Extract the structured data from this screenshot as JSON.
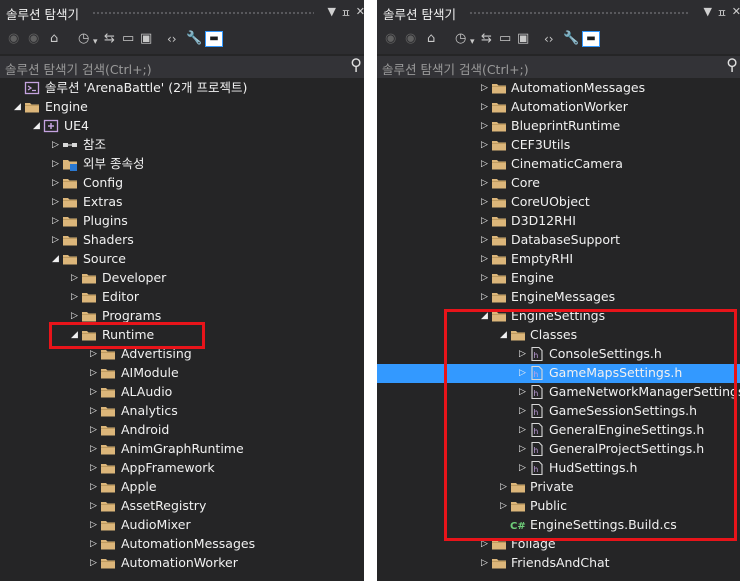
{
  "panels": [
    {
      "title": "솔루션 탐색기",
      "title_icons": [
        "▼",
        "ㅍ",
        "✕"
      ],
      "search_placeholder": "솔루션 탐색기 검색(Ctrl+;)",
      "rows": [
        {
          "label": "솔루션 'ArenaBattle' (2개 프로젝트)",
          "icon": "solution-icon",
          "level": 0,
          "exp": "none",
          "sel": false
        },
        {
          "label": "Engine",
          "icon": "folder-icon",
          "level": 0,
          "exp": "open",
          "sel": false
        },
        {
          "label": "UE4",
          "icon": "project-icon",
          "level": 1,
          "exp": "open",
          "sel": false
        },
        {
          "label": "참조",
          "icon": "references-icon",
          "level": 2,
          "exp": "closed",
          "sel": false
        },
        {
          "label": "외부 종속성",
          "icon": "external-deps-icon",
          "level": 2,
          "exp": "closed",
          "sel": false
        },
        {
          "label": "Config",
          "icon": "folder-icon",
          "level": 2,
          "exp": "closed",
          "sel": false
        },
        {
          "label": "Extras",
          "icon": "folder-icon",
          "level": 2,
          "exp": "closed",
          "sel": false
        },
        {
          "label": "Plugins",
          "icon": "folder-icon",
          "level": 2,
          "exp": "closed",
          "sel": false
        },
        {
          "label": "Shaders",
          "icon": "folder-icon",
          "level": 2,
          "exp": "closed",
          "sel": false
        },
        {
          "label": "Source",
          "icon": "folder-icon",
          "level": 2,
          "exp": "open",
          "sel": false
        },
        {
          "label": "Developer",
          "icon": "folder-icon",
          "level": 3,
          "exp": "closed",
          "sel": false
        },
        {
          "label": "Editor",
          "icon": "folder-icon",
          "level": 3,
          "exp": "closed",
          "sel": false
        },
        {
          "label": "Programs",
          "icon": "folder-icon",
          "level": 3,
          "exp": "closed",
          "sel": false
        },
        {
          "label": "Runtime",
          "icon": "folder-icon",
          "level": 3,
          "exp": "open",
          "sel": false
        },
        {
          "label": "Advertising",
          "icon": "folder-icon",
          "level": 4,
          "exp": "closed",
          "sel": false
        },
        {
          "label": "AIModule",
          "icon": "folder-icon",
          "level": 4,
          "exp": "closed",
          "sel": false
        },
        {
          "label": "ALAudio",
          "icon": "folder-icon",
          "level": 4,
          "exp": "closed",
          "sel": false
        },
        {
          "label": "Analytics",
          "icon": "folder-icon",
          "level": 4,
          "exp": "closed",
          "sel": false
        },
        {
          "label": "Android",
          "icon": "folder-icon",
          "level": 4,
          "exp": "closed",
          "sel": false
        },
        {
          "label": "AnimGraphRuntime",
          "icon": "folder-icon",
          "level": 4,
          "exp": "closed",
          "sel": false
        },
        {
          "label": "AppFramework",
          "icon": "folder-icon",
          "level": 4,
          "exp": "closed",
          "sel": false
        },
        {
          "label": "Apple",
          "icon": "folder-icon",
          "level": 4,
          "exp": "closed",
          "sel": false
        },
        {
          "label": "AssetRegistry",
          "icon": "folder-icon",
          "level": 4,
          "exp": "closed",
          "sel": false
        },
        {
          "label": "AudioMixer",
          "icon": "folder-icon",
          "level": 4,
          "exp": "closed",
          "sel": false
        },
        {
          "label": "AutomationMessages",
          "icon": "folder-icon",
          "level": 4,
          "exp": "closed",
          "sel": false
        },
        {
          "label": "AutomationWorker",
          "icon": "folder-icon",
          "level": 4,
          "exp": "closed",
          "sel": false
        }
      ]
    },
    {
      "title": "솔루션 탐색기",
      "title_icons": [
        "▼",
        "ㅍ",
        "✕"
      ],
      "search_placeholder": "솔루션 탐색기 검색(Ctrl+;)",
      "rows": [
        {
          "label": "AutomationMessages",
          "icon": "folder-icon",
          "level": 1,
          "exp": "closed",
          "sel": false
        },
        {
          "label": "AutomationWorker",
          "icon": "folder-icon",
          "level": 1,
          "exp": "closed",
          "sel": false
        },
        {
          "label": "BlueprintRuntime",
          "icon": "folder-icon",
          "level": 1,
          "exp": "closed",
          "sel": false
        },
        {
          "label": "CEF3Utils",
          "icon": "folder-icon",
          "level": 1,
          "exp": "closed",
          "sel": false
        },
        {
          "label": "CinematicCamera",
          "icon": "folder-icon",
          "level": 1,
          "exp": "closed",
          "sel": false
        },
        {
          "label": "Core",
          "icon": "folder-icon",
          "level": 1,
          "exp": "closed",
          "sel": false
        },
        {
          "label": "CoreUObject",
          "icon": "folder-icon",
          "level": 1,
          "exp": "closed",
          "sel": false
        },
        {
          "label": "D3D12RHI",
          "icon": "folder-icon",
          "level": 1,
          "exp": "closed",
          "sel": false
        },
        {
          "label": "DatabaseSupport",
          "icon": "folder-icon",
          "level": 1,
          "exp": "closed",
          "sel": false
        },
        {
          "label": "EmptyRHI",
          "icon": "folder-icon",
          "level": 1,
          "exp": "closed",
          "sel": false
        },
        {
          "label": "Engine",
          "icon": "folder-icon",
          "level": 1,
          "exp": "closed",
          "sel": false
        },
        {
          "label": "EngineMessages",
          "icon": "folder-icon",
          "level": 1,
          "exp": "closed",
          "sel": false
        },
        {
          "label": "EngineSettings",
          "icon": "folder-icon",
          "level": 1,
          "exp": "open",
          "sel": false
        },
        {
          "label": "Classes",
          "icon": "folder-icon",
          "level": 2,
          "exp": "open",
          "sel": false
        },
        {
          "label": "ConsoleSettings.h",
          "icon": "header-file-icon",
          "level": 3,
          "exp": "closed",
          "sel": false
        },
        {
          "label": "GameMapsSettings.h",
          "icon": "header-file-icon",
          "level": 3,
          "exp": "closed",
          "sel": true
        },
        {
          "label": "GameNetworkManagerSettings.h",
          "icon": "header-file-icon",
          "level": 3,
          "exp": "closed",
          "sel": false
        },
        {
          "label": "GameSessionSettings.h",
          "icon": "header-file-icon",
          "level": 3,
          "exp": "closed",
          "sel": false
        },
        {
          "label": "GeneralEngineSettings.h",
          "icon": "header-file-icon",
          "level": 3,
          "exp": "closed",
          "sel": false
        },
        {
          "label": "GeneralProjectSettings.h",
          "icon": "header-file-icon",
          "level": 3,
          "exp": "closed",
          "sel": false
        },
        {
          "label": "HudSettings.h",
          "icon": "header-file-icon",
          "level": 3,
          "exp": "closed",
          "sel": false
        },
        {
          "label": "Private",
          "icon": "folder-icon",
          "level": 2,
          "exp": "closed",
          "sel": false
        },
        {
          "label": "Public",
          "icon": "folder-icon",
          "level": 2,
          "exp": "closed",
          "sel": false
        },
        {
          "label": "EngineSettings.Build.cs",
          "icon": "csharp-file-icon",
          "level": 2,
          "exp": "none",
          "sel": false
        },
        {
          "label": "Foliage",
          "icon": "folder-icon",
          "level": 1,
          "exp": "closed",
          "sel": false
        },
        {
          "label": "FriendsAndChat",
          "icon": "folder-icon",
          "level": 1,
          "exp": "closed",
          "sel": false
        }
      ]
    }
  ],
  "colors": {
    "background": "#252526",
    "toolbar": "#2d2d30",
    "search": "#333337",
    "text": "#f1f1f1",
    "selection": "#3399ff",
    "folder": "#dcb67a",
    "highlight_box": "#e8141a"
  }
}
